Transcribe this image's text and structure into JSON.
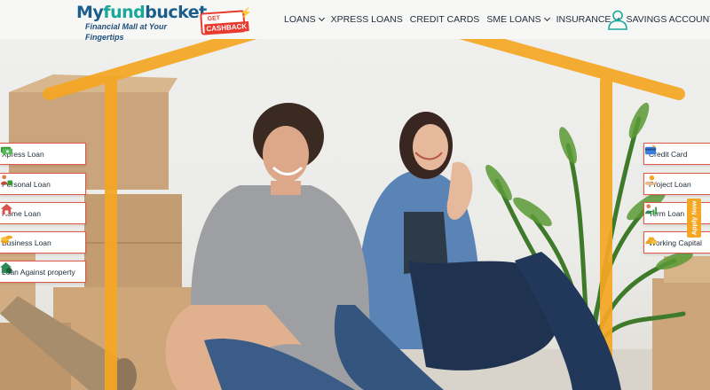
{
  "brand": {
    "logo_my": "My",
    "logo_fund": "fund",
    "logo_bucket": "bucket",
    "tagline": "Financial Mall at Your Fingertips",
    "cashback_get": "GET",
    "cashback_label": "CASHBACK"
  },
  "nav": {
    "items": [
      {
        "label": "LOANS",
        "dropdown": true
      },
      {
        "label": "XPRESS LOANS",
        "dropdown": false
      },
      {
        "label": "CREDIT CARDS",
        "dropdown": false
      },
      {
        "label": "SME LOANS",
        "dropdown": true
      },
      {
        "label": "INSURANCE",
        "dropdown": true
      },
      {
        "label": "SAVINGS ACCOUNT",
        "dropdown": false
      }
    ]
  },
  "left_menu": {
    "items": [
      {
        "label": "Xpress Loan",
        "icon": "money-stack-icon"
      },
      {
        "label": "Personal Loan",
        "icon": "person-money-icon"
      },
      {
        "label": "Home Loan",
        "icon": "house-icon"
      },
      {
        "label": "Business Loan",
        "icon": "coins-icon"
      },
      {
        "label": "Loan Against property",
        "icon": "property-icon"
      }
    ]
  },
  "right_menu": {
    "items": [
      {
        "label": "Credit Card",
        "icon": "credit-card-icon"
      },
      {
        "label": "Project Loan",
        "icon": "hand-coin-icon"
      },
      {
        "label": "Term Loan",
        "icon": "person-chart-icon"
      },
      {
        "label": "Working Capital",
        "icon": "gold-bars-icon"
      }
    ]
  },
  "apply_now": "Apply Now",
  "colors": {
    "accent_orange": "#f5a623",
    "menu_border": "#e05a4a",
    "brand_teal": "#19a89a",
    "brand_blue": "#1a5e8c"
  }
}
